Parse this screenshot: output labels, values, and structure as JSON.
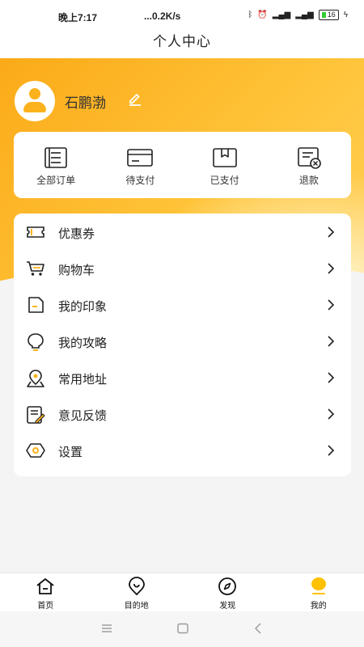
{
  "status_bar": {
    "time": "晚上7:17",
    "network_speed": "...0.2K/s",
    "battery": "16"
  },
  "header": {
    "title": "个人中心"
  },
  "profile": {
    "username": "石鹏渤"
  },
  "orders": [
    {
      "label": "全部订单",
      "icon": "order-list-icon"
    },
    {
      "label": "待支付",
      "icon": "card-icon"
    },
    {
      "label": "已支付",
      "icon": "box-icon"
    },
    {
      "label": "退款",
      "icon": "refund-icon"
    }
  ],
  "menu": [
    {
      "label": "优惠券",
      "icon": "coupon-icon"
    },
    {
      "label": "购物车",
      "icon": "cart-icon"
    },
    {
      "label": "我的印象",
      "icon": "impression-icon"
    },
    {
      "label": "我的攻略",
      "icon": "bulb-icon"
    },
    {
      "label": "常用地址",
      "icon": "location-icon"
    },
    {
      "label": "意见反馈",
      "icon": "feedback-icon"
    },
    {
      "label": "设置",
      "icon": "settings-icon"
    }
  ],
  "tabbar": [
    {
      "label": "首页",
      "icon": "home-icon"
    },
    {
      "label": "目的地",
      "icon": "destination-icon"
    },
    {
      "label": "发现",
      "icon": "compass-icon"
    },
    {
      "label": "我的",
      "icon": "profile-tab-icon",
      "active": true
    }
  ],
  "colors": {
    "accent": "#fcb21c",
    "tab_active": "#ffc000",
    "icon_dark": "#222222"
  }
}
